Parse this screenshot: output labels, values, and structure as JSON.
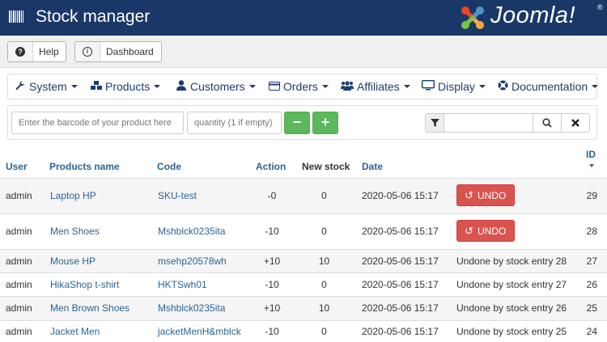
{
  "header": {
    "title": "Stock manager",
    "brand": "Joomla!",
    "reg": "®",
    "bg_color": "#1a3867"
  },
  "toolbar": {
    "help_label": "Help",
    "help_icon": "question-circle-icon",
    "dashboard_label": "Dashboard",
    "dashboard_icon": "info-circle-icon"
  },
  "menu": [
    {
      "label": "System",
      "icon": "wrench-icon",
      "glyph": "🔧"
    },
    {
      "label": "Products",
      "icon": "cubes-icon",
      "glyph": "⬢"
    },
    {
      "label": "Customers",
      "icon": "user-icon",
      "glyph": "👤"
    },
    {
      "label": "Orders",
      "icon": "credit-card-icon",
      "glyph": "▭"
    },
    {
      "label": "Affiliates",
      "icon": "users-icon",
      "glyph": "👥"
    },
    {
      "label": "Display",
      "icon": "monitor-icon",
      "glyph": "🖥"
    },
    {
      "label": "Documentation",
      "icon": "life-ring-icon",
      "glyph": "✪"
    }
  ],
  "filters": {
    "barcode_placeholder": "Enter the barcode of your product here",
    "quantity_placeholder": "quantity (1 if empty)",
    "minus_label": "−",
    "plus_label": "+",
    "search_value": ""
  },
  "table": {
    "columns": {
      "user": "User",
      "product": "Products name",
      "code": "Code",
      "action": "Action",
      "new_stock": "New stock",
      "date": "Date",
      "id": "ID"
    },
    "undo_label": "UNDO",
    "rows": [
      {
        "user": "admin",
        "product": "Laptop HP",
        "code": "SKU-test",
        "action": "-0",
        "new_stock": "0",
        "date": "2020-05-06 15:17",
        "status": "",
        "undo": true,
        "id": "29"
      },
      {
        "user": "admin",
        "product": "Men Shoes",
        "code": "Mshblck0235ita",
        "action": "-10",
        "new_stock": "0",
        "date": "2020-05-06 15:17",
        "status": "",
        "undo": true,
        "id": "28"
      },
      {
        "user": "admin",
        "product": "Mouse HP",
        "code": "msehp20578wh",
        "action": "+10",
        "new_stock": "10",
        "date": "2020-05-06 15:17",
        "status": "Undone by stock entry 28",
        "undo": false,
        "id": "27"
      },
      {
        "user": "admin",
        "product": "HikaShop t-shirt",
        "code": "HKTSwh01",
        "action": "-10",
        "new_stock": "0",
        "date": "2020-05-06 15:17",
        "status": "Undone by stock entry 27",
        "undo": false,
        "id": "26"
      },
      {
        "user": "admin",
        "product": "Men Brown Shoes",
        "code": "Mshblck0235ita",
        "action": "+10",
        "new_stock": "10",
        "date": "2020-05-06 15:17",
        "status": "Undone by stock entry 26",
        "undo": false,
        "id": "25"
      },
      {
        "user": "admin",
        "product": "Jacket Men",
        "code": "jacketMenH&mblck",
        "action": "-10",
        "new_stock": "0",
        "date": "2020-05-06 15:17",
        "status": "Undone by stock entry 25",
        "undo": false,
        "id": "24"
      }
    ]
  }
}
